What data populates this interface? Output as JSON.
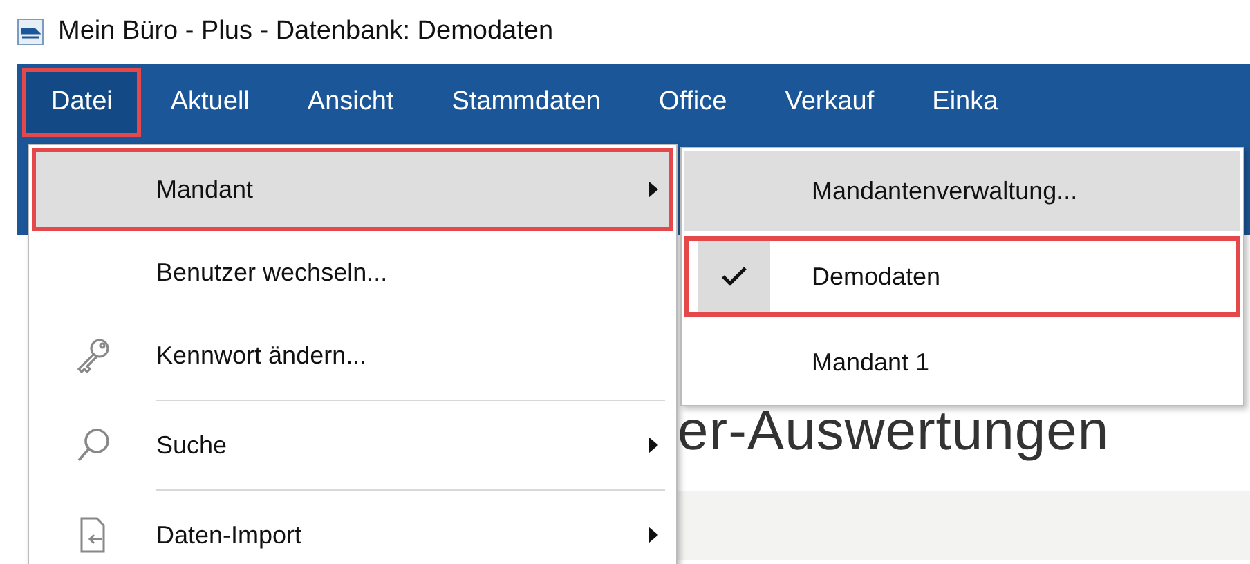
{
  "window": {
    "title": "Mein Büro - Plus - Datenbank: Demodaten"
  },
  "menu_bar": [
    {
      "label": "Datei",
      "selected": true,
      "highlighted": true
    },
    {
      "label": "Aktuell",
      "selected": false,
      "highlighted": false
    },
    {
      "label": "Ansicht",
      "selected": false,
      "highlighted": false
    },
    {
      "label": "Stammdaten",
      "selected": false,
      "highlighted": false
    },
    {
      "label": "Office",
      "selected": false,
      "highlighted": false
    },
    {
      "label": "Verkauf",
      "selected": false,
      "highlighted": false
    },
    {
      "label": "Einka",
      "selected": false,
      "highlighted": false
    }
  ],
  "file_menu": [
    {
      "kind": "submenu",
      "label": "Mandant",
      "hovered": true,
      "highlighted": true
    },
    {
      "kind": "command",
      "label": "Benutzer wechseln...",
      "hovered": false,
      "highlighted": false
    },
    {
      "kind": "command",
      "label": "Kennwort ändern...",
      "hovered": false,
      "highlighted": false
    },
    {
      "kind": "separator"
    },
    {
      "kind": "submenu",
      "label": "Suche",
      "hovered": false,
      "highlighted": false
    },
    {
      "kind": "separator"
    },
    {
      "kind": "submenu",
      "label": "Daten-Import",
      "hovered": false,
      "highlighted": false
    }
  ],
  "mandant_submenu": [
    {
      "label": "Mandantenverwaltung...",
      "hovered": true,
      "checked": false,
      "highlighted": false
    },
    {
      "label": "Demodaten",
      "hovered": false,
      "checked": true,
      "highlighted": true
    },
    {
      "label": "Mandant 1",
      "hovered": false,
      "checked": false,
      "highlighted": false
    }
  ],
  "content": {
    "heading": "er-Auswertungen"
  }
}
